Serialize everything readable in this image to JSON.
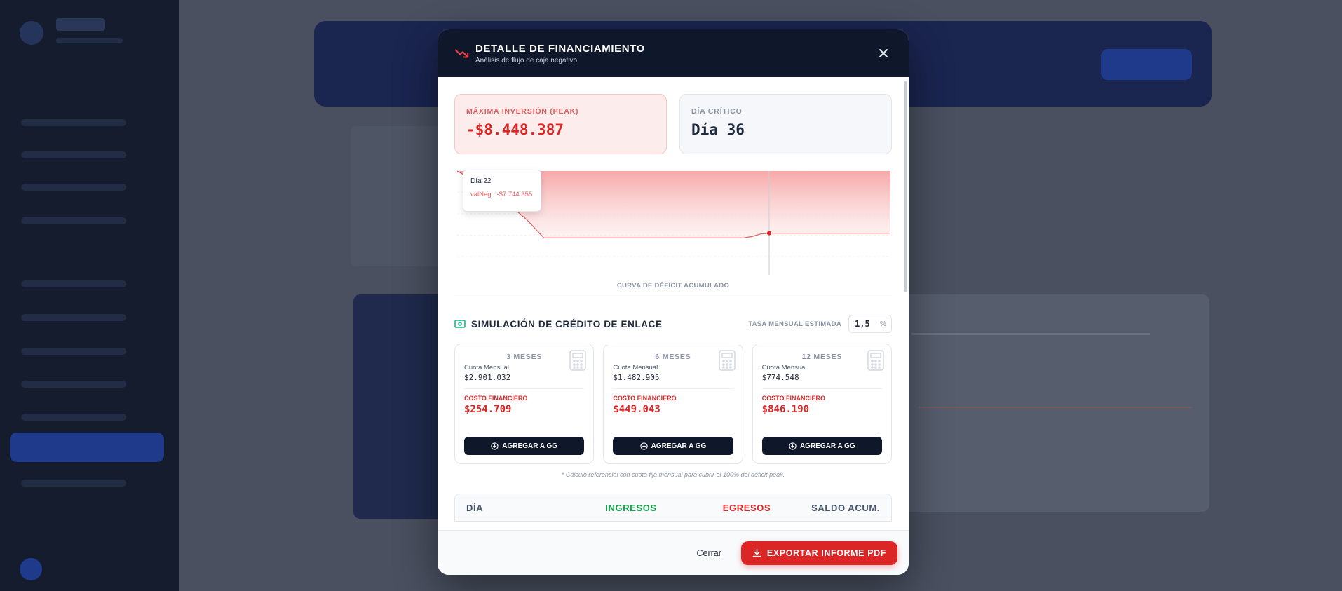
{
  "modal": {
    "title": "DETALLE DE FINANCIAMIENTO",
    "subtitle": "Análisis de flujo de caja negativo"
  },
  "kpis": {
    "peak_label": "MÁXIMA INVERSIÓN (PEAK)",
    "peak_value": "-$8.448.387",
    "day_label": "DÍA CRÍTICO",
    "day_value": "Día 36"
  },
  "chart": {
    "tooltip_day": "Día 22",
    "tooltip_value": "valNeg : -$7.744.355",
    "caption": "CURVA DE DÉFICIT ACUMULADO"
  },
  "simulation": {
    "title": "SIMULACIÓN DE CRÉDITO DE ENLACE",
    "rate_label": "TASA MENSUAL ESTIMADA",
    "rate_value": "1,5",
    "rate_unit": "%",
    "quota_label": "Cuota Mensual",
    "cost_label": "COSTO FINANCIERO",
    "button_label": "AGREGAR A GG",
    "plans": [
      {
        "term": "3 MESES",
        "quota": "$2.901.032",
        "cost": "$254.709"
      },
      {
        "term": "6 MESES",
        "quota": "$1.482.905",
        "cost": "$449.043"
      },
      {
        "term": "12 MESES",
        "quota": "$774.548",
        "cost": "$846.190"
      }
    ],
    "footnote": "* Cálculo referencial con cuota fija mensual para cubrir el 100% del déficit peak."
  },
  "table": {
    "col_day": "DÍA",
    "col_in": "INGRESOS",
    "col_out": "EGRESOS",
    "col_balance": "SALDO ACUM."
  },
  "footer": {
    "cancel_label": "Cerrar",
    "export_label": "EXPORTAR INFORME PDF"
  },
  "colors": {
    "accent": "#dc2626",
    "header": "#0f172a",
    "income": "#16a34a"
  },
  "icons": {
    "title": "trending-down-icon",
    "close": "close-icon",
    "simulation": "banknote-icon",
    "plan": "calculator-icon",
    "add": "plus-circle-icon",
    "export": "download-icon"
  },
  "chart_data": {
    "type": "area",
    "xlabel": "CURVA DE DÉFICIT ACUMULADO",
    "ylabel": "",
    "series": [
      {
        "name": "valNeg",
        "x": [
          0,
          4,
          8,
          10,
          12,
          20,
          28,
          33,
          34,
          35,
          36,
          40,
          50
        ],
        "y": [
          0,
          -2200000,
          -5600000,
          -7744355,
          -7744355,
          -7744355,
          -7744355,
          -7744355,
          -7600000,
          -7300000,
          -7200000,
          -7200000,
          -7200000
        ]
      }
    ],
    "highlight": {
      "x": 36,
      "label": "Día 36"
    },
    "grid": true
  }
}
